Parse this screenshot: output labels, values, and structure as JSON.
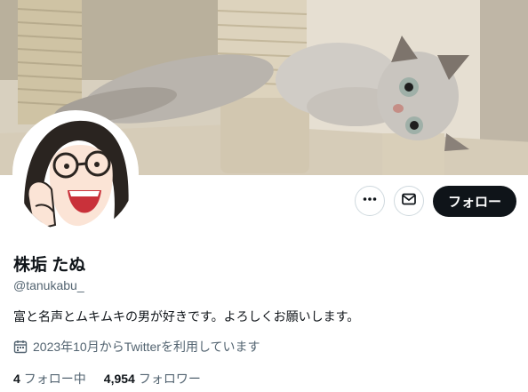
{
  "profile": {
    "display_name": "株垢 たぬ",
    "handle": "@tanukabu_",
    "bio": "富と名声とムキムキの男が好きです。よろしくお願いします。",
    "joined": "2023年10月からTwitterを利用しています",
    "following_count": "4",
    "following_label": "フォロー中",
    "followers_count": "4,954",
    "followers_label": "フォロワー"
  },
  "actions": {
    "follow_label": "フォロー",
    "more_icon": "more-dots-icon",
    "message_icon": "envelope-icon"
  },
  "colors": {
    "text": "#0f1419",
    "muted": "#536471",
    "button": "#0f1419",
    "border": "#cfd9de"
  }
}
